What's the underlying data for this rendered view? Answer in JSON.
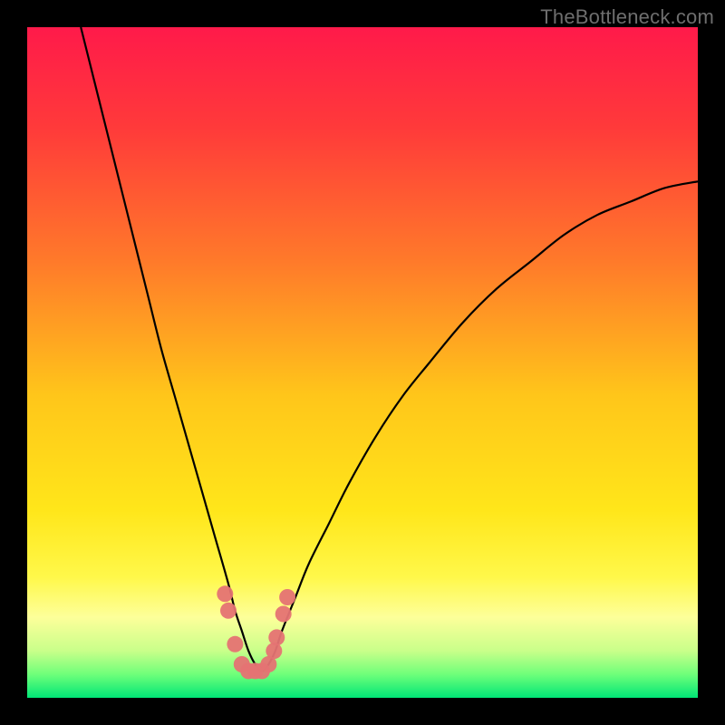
{
  "watermark": "TheBottleneck.com",
  "chart_data": {
    "type": "line",
    "title": "",
    "xlabel": "",
    "ylabel": "",
    "xlim": [
      0,
      100
    ],
    "ylim": [
      0,
      100
    ],
    "grid": false,
    "background_gradient": [
      {
        "stop": 0.0,
        "color": "#ff1a4a"
      },
      {
        "stop": 0.15,
        "color": "#ff3a3a"
      },
      {
        "stop": 0.35,
        "color": "#ff7a2a"
      },
      {
        "stop": 0.55,
        "color": "#ffc61a"
      },
      {
        "stop": 0.72,
        "color": "#ffe61a"
      },
      {
        "stop": 0.82,
        "color": "#fff84a"
      },
      {
        "stop": 0.88,
        "color": "#fdff9a"
      },
      {
        "stop": 0.93,
        "color": "#c9ff8a"
      },
      {
        "stop": 0.965,
        "color": "#6fff7a"
      },
      {
        "stop": 1.0,
        "color": "#00e676"
      }
    ],
    "series": [
      {
        "name": "bottleneck-curve",
        "color": "#000000",
        "x": [
          8,
          10,
          12,
          14,
          16,
          18,
          20,
          22,
          24,
          26,
          28,
          30,
          31,
          32,
          33,
          34,
          35,
          36,
          37,
          38,
          40,
          42,
          45,
          48,
          52,
          56,
          60,
          65,
          70,
          75,
          80,
          85,
          90,
          95,
          100
        ],
        "y": [
          100,
          92,
          84,
          76,
          68,
          60,
          52,
          45,
          38,
          31,
          24,
          17,
          13,
          10,
          7,
          5,
          4,
          5,
          7,
          10,
          15,
          20,
          26,
          32,
          39,
          45,
          50,
          56,
          61,
          65,
          69,
          72,
          74,
          76,
          77
        ]
      },
      {
        "name": "dot-cluster",
        "color": "#e57373",
        "type": "scatter",
        "x": [
          29.5,
          30.0,
          31.0,
          32.0,
          33.0,
          34.0,
          35.0,
          36.0,
          36.8,
          37.2,
          38.2,
          38.8
        ],
        "y": [
          15.5,
          13.0,
          8.0,
          5.0,
          4.0,
          4.0,
          4.0,
          5.0,
          7.0,
          9.0,
          12.5,
          15.0
        ]
      }
    ],
    "annotations": []
  }
}
